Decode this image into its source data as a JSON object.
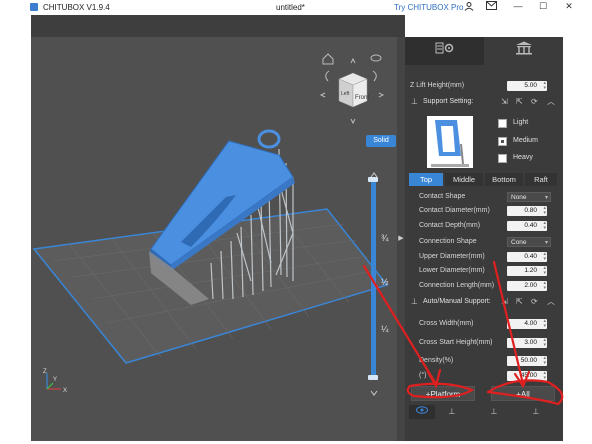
{
  "title_bar": {
    "app_name": "CHITUBOX V1.9.4",
    "document": "untitled*",
    "promo": "Try CHITUBOX Pro",
    "user_icon": "user-icon",
    "mail_icon": "mail-icon",
    "minimize": "—",
    "maximize": "☐",
    "close": "✕"
  },
  "viewport": {
    "view_cube_face": "Front",
    "view_cube_side": "Left",
    "render_mode": "Solid",
    "slider_marks": [
      "¼",
      "½",
      "¾"
    ],
    "axes": [
      "Z",
      "X",
      "Y"
    ]
  },
  "panel": {
    "tabs": [
      {
        "icon": "settings-icon"
      },
      {
        "icon": "supports-icon"
      }
    ],
    "z_lift_height": {
      "label": "Z Lift Height(mm)",
      "value": "5.00"
    },
    "support_setting": {
      "label": "Support Setting:"
    },
    "density_options": [
      {
        "label": "Light",
        "checked": false
      },
      {
        "label": "Medium",
        "checked": true
      },
      {
        "label": "Heavy",
        "checked": false
      }
    ],
    "sub_tabs": [
      "Top",
      "Middle",
      "Bottom",
      "Raft"
    ],
    "active_sub_tab": "Top",
    "params": [
      {
        "label": "Contact Shape",
        "value": "None",
        "type": "select"
      },
      {
        "label": "Contact Diameter(mm)",
        "value": "0.80",
        "type": "number"
      },
      {
        "label": "Contact Depth(mm)",
        "value": "0.40",
        "type": "number"
      },
      {
        "label": "Connection Shape",
        "value": "Cone",
        "type": "select"
      },
      {
        "label": "Upper Diameter(mm)",
        "value": "0.40",
        "type": "number"
      },
      {
        "label": "Lower Diameter(mm)",
        "value": "1.20",
        "type": "number"
      },
      {
        "label": "Connection Length(mm)",
        "value": "2.00",
        "type": "number"
      }
    ],
    "auto_support": {
      "label": "Auto/Manual Support:"
    },
    "auto_params": [
      {
        "label": "Cross Width(mm)",
        "value": "4.00"
      },
      {
        "label": "Cross Start Height(mm)",
        "value": "3.00"
      },
      {
        "label": "Density(%)",
        "value": "50.00"
      },
      {
        "label": "(°)",
        "value": "45.00"
      }
    ],
    "platform_button": "+Platform",
    "all_button": "+All"
  },
  "colors": {
    "accent": "#3a86d6",
    "model": "#4b8fe0",
    "annotation": "#e02020"
  }
}
